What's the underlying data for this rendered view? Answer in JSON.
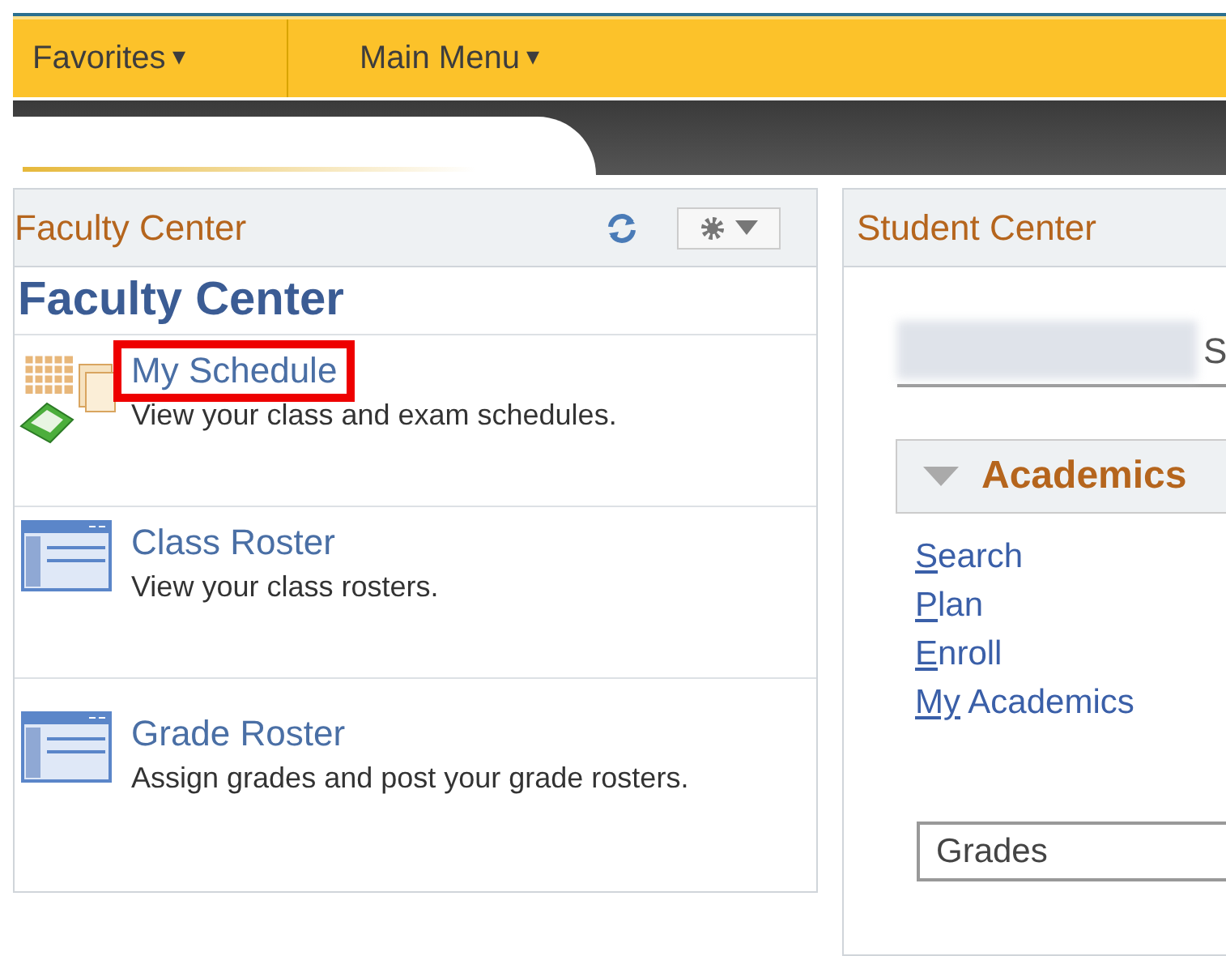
{
  "menu_bar": {
    "items": [
      {
        "label": "Favorites",
        "caret": "▾"
      },
      {
        "label": "Main Menu",
        "caret": "▾"
      }
    ]
  },
  "faculty_panel": {
    "title": "Faculty Center",
    "heading": "Faculty Center",
    "items": [
      {
        "kind": "schedule",
        "title": "My Schedule",
        "description": "View your class and exam schedules.",
        "highlighted": true
      },
      {
        "kind": "roster",
        "title": "Class Roster",
        "description": "View your class rosters.",
        "highlighted": false
      },
      {
        "kind": "roster",
        "title": "Grade Roster",
        "description": "Assign grades and post your grade rosters.",
        "highlighted": false
      }
    ]
  },
  "student_panel": {
    "title": "Student Center",
    "name_title": {
      "text": "S",
      "redacted": true
    },
    "section": {
      "title": "Academics",
      "expanded": true
    },
    "links": [
      {
        "key": "S",
        "rest": "earch"
      },
      {
        "key": "P",
        "rest": "lan"
      },
      {
        "key": "E",
        "rest": "nroll"
      },
      {
        "key": "My",
        "rest": " Academics"
      }
    ],
    "select": {
      "value": "Grades"
    }
  }
}
